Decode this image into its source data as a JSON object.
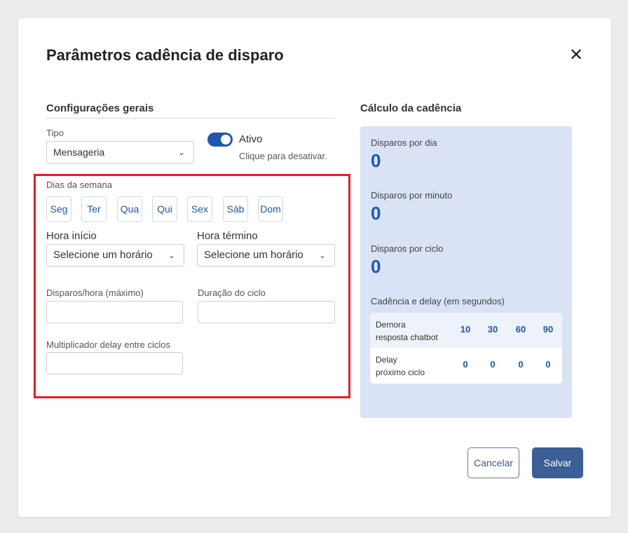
{
  "modal": {
    "title": "Parâmetros cadência de disparo",
    "close_icon": "close-icon",
    "close_glyph": "✕"
  },
  "general": {
    "section_title": "Configurações gerais",
    "tipo_label": "Tipo",
    "tipo_value": "Mensageria",
    "toggle_label": "Ativo",
    "toggle_hint": "Clique para desativar.",
    "toggle_on": true,
    "days_label": "Dias da semana",
    "days": [
      "Seg",
      "Ter",
      "Qua",
      "Qui",
      "Sex",
      "Sáb",
      "Dom"
    ],
    "hora_inicio_label": "Hora início",
    "hora_inicio_placeholder": "Selecione um horário",
    "hora_termino_label": "Hora término",
    "hora_termino_placeholder": "Selecione um horário",
    "disparos_hora_label": "Disparos/hora (máximo)",
    "disparos_hora_value": "",
    "duracao_ciclo_label": "Duração do ciclo",
    "duracao_ciclo_value": "",
    "multiplicador_label": "Multiplicador delay entre ciclos",
    "multiplicador_value": ""
  },
  "calc": {
    "section_title": "Cálculo da cadência",
    "disparos_dia_label": "Disparos por dia",
    "disparos_dia_value": "0",
    "disparos_minuto_label": "Disparos por minuto",
    "disparos_minuto_value": "0",
    "disparos_ciclo_label": "Disparos por ciclo",
    "disparos_ciclo_value": "0",
    "table_title": "Cadência e delay (em segundos)",
    "rows": [
      {
        "label_line1": "Demora",
        "label_line2": "resposta chatbot",
        "values": [
          "10",
          "30",
          "60",
          "90"
        ]
      },
      {
        "label_line1": "Delay",
        "label_line2": "próximo ciclo",
        "values": [
          "0",
          "0",
          "0",
          "0"
        ]
      }
    ]
  },
  "actions": {
    "cancel_label": "Cancelar",
    "save_label": "Salvar"
  },
  "colors": {
    "accent": "#1e56b4",
    "highlight_box": "#e02020",
    "calc_panel": "#d9e3f5",
    "save_button": "#3b5f96"
  }
}
